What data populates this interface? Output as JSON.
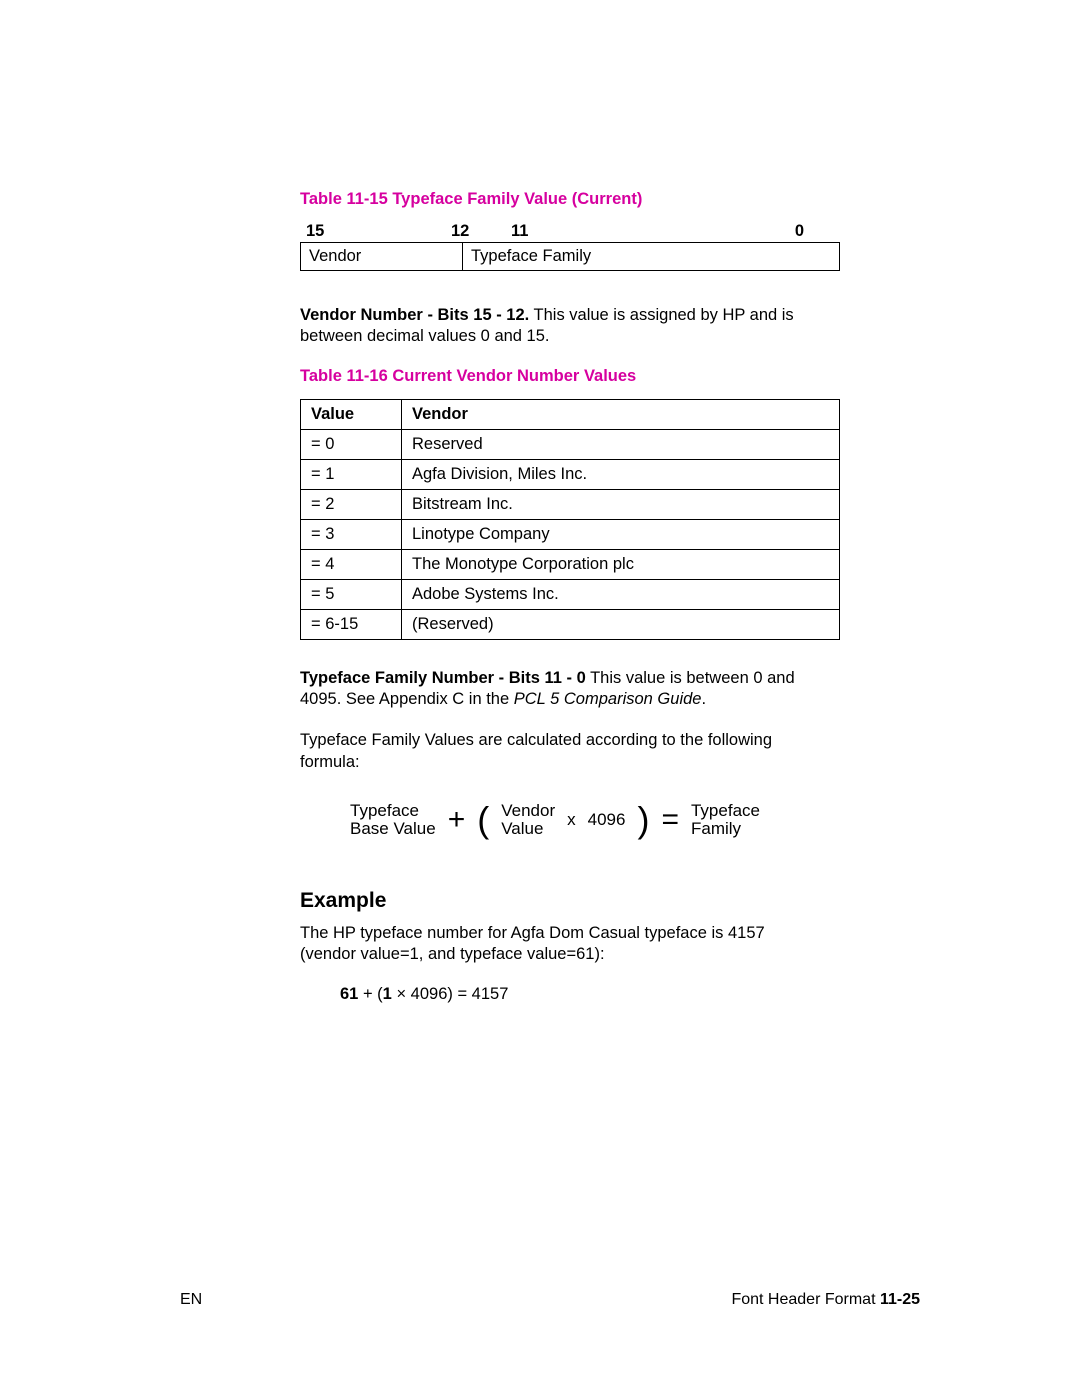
{
  "table15": {
    "caption": "Table 11-15  Typeface Family Value (Current)",
    "bits": {
      "left": "15",
      "mid_left": "12",
      "mid_right": "11",
      "right": "0"
    },
    "row": {
      "c1": "Vendor",
      "c2": "Typeface Family"
    }
  },
  "para1": {
    "bold": "Vendor Number - Bits 15 - 12.",
    "rest": " This value is assigned by HP and is between decimal values 0 and 15."
  },
  "table16": {
    "caption": "Table 11-16  Current Vendor Number Values",
    "headers": {
      "c1": "Value",
      "c2": "Vendor"
    },
    "rows": [
      {
        "c1": "= 0",
        "c2": "Reserved"
      },
      {
        "c1": "= 1",
        "c2": "Agfa Division, Miles Inc."
      },
      {
        "c1": "= 2",
        "c2": "Bitstream Inc."
      },
      {
        "c1": "= 3",
        "c2": "Linotype Company"
      },
      {
        "c1": "= 4",
        "c2": "The Monotype Corporation plc"
      },
      {
        "c1": "= 5",
        "c2": "Adobe Systems Inc."
      },
      {
        "c1": "= 6-15",
        "c2": "(Reserved)"
      }
    ]
  },
  "para2": {
    "bold": "Typeface Family Number - Bits 11 - 0",
    "rest": " This value is between 0 and 4095. See Appendix C in the ",
    "italic": "PCL 5 Comparison Guide",
    "after": "."
  },
  "para3": "Typeface Family Values are calculated according to the following formula:",
  "formula": {
    "left_top": "Typeface",
    "left_bot": "Base Value",
    "plus": "+",
    "mid_top": "Vendor",
    "mid_bot": "Value",
    "times": "x",
    "factor": "4096",
    "equals": "=",
    "right_top": "Typeface",
    "right_bot": "Family"
  },
  "example": {
    "heading": "Example",
    "text": "The HP typeface number for Agfa Dom Casual typeface is 4157 (vendor value=1, and typeface value=61):",
    "calc_bold1": "61",
    "calc_mid1": " + (",
    "calc_bold2": "1",
    "calc_mid2": " × 4096) = 4157"
  },
  "footer": {
    "left": "EN",
    "mid": "Font Header Format ",
    "page": "11-25"
  }
}
